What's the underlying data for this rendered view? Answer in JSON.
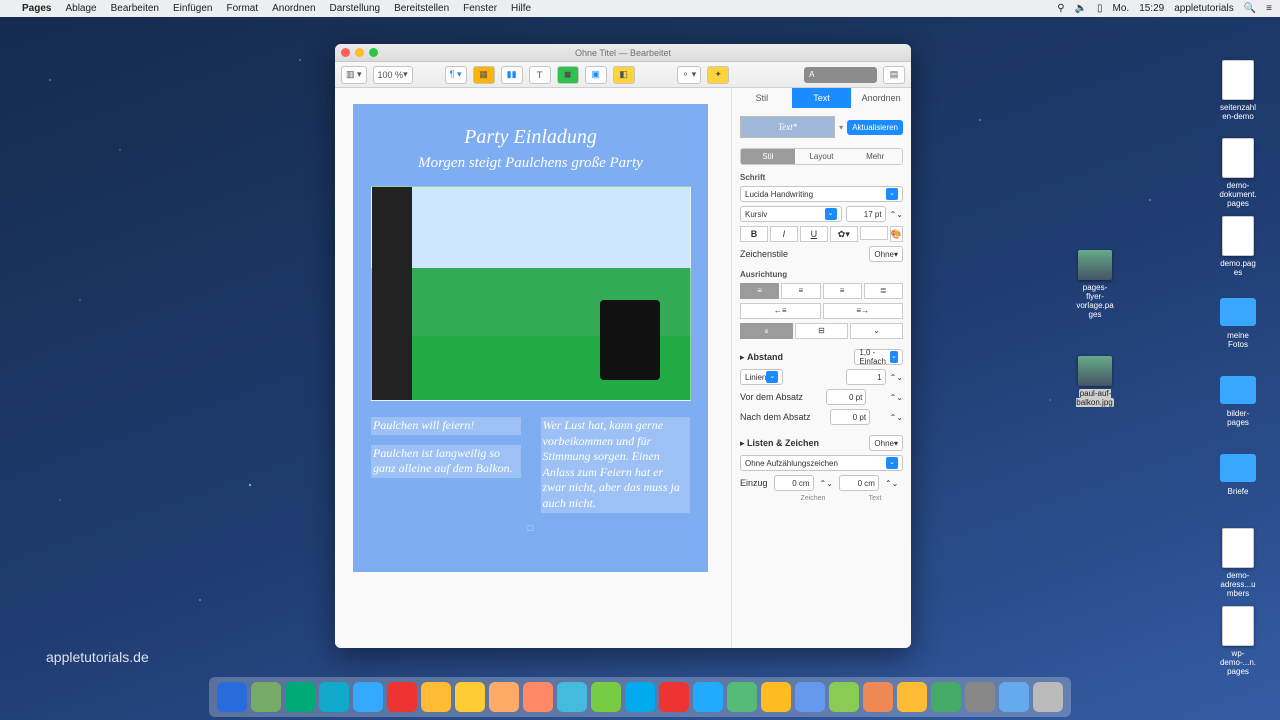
{
  "menubar": {
    "app": "Pages",
    "items": [
      "Ablage",
      "Bearbeiten",
      "Einfügen",
      "Format",
      "Anordnen",
      "Darstellung",
      "Bereitstellen",
      "Fenster",
      "Hilfe"
    ],
    "right": {
      "day": "Mo.",
      "time": "15:29",
      "user": "appletutorials"
    }
  },
  "window": {
    "title": "Ohne Titel — Bearbeitet",
    "zoom": "100 %"
  },
  "doc": {
    "title": "Party Einladung",
    "subtitle": "Morgen steigt Paulchens große Party",
    "col1a": "Paulchen will feiern!",
    "col1b": "Paulchen ist langweilig so ganz alleine auf dem Balkon.",
    "col2": "Wer Lust hat, kann gerne vorbeikommen und für Stimmung sorgen. Einen Anlass zum Feiern hat er zwar nicht, aber das muss ja auch nicht."
  },
  "inspector": {
    "tabs": {
      "stil": "Stil",
      "text": "Text",
      "anordnen": "Anordnen"
    },
    "styleName": "Text*",
    "update": "Aktualisieren",
    "subtabs": {
      "stil": "Stil",
      "layout": "Layout",
      "mehr": "Mehr"
    },
    "font": {
      "label": "Schrift",
      "family": "Lucida Handwriting",
      "typeface": "Kursiv",
      "size": "17 pt",
      "charStyleLabel": "Zeichenstile",
      "charStyle": "Ohne"
    },
    "align": {
      "label": "Ausrichtung"
    },
    "spacing": {
      "label": "Abstand",
      "value": "1,0 - Einfach",
      "linesLabel": "Linien",
      "linesVal": "1",
      "beforeLabel": "Vor dem Absatz",
      "beforeVal": "0 pt",
      "afterLabel": "Nach dem Absatz",
      "afterVal": "0 pt"
    },
    "lists": {
      "label": "Listen & Zeichen",
      "value": "Ohne",
      "bulletStyle": "Ohne Aufzählungszeichen",
      "indentLabel": "Einzug",
      "indentBullet": "0 cm",
      "indentText": "0 cm",
      "colBullet": "Zeichen",
      "colText": "Text"
    }
  },
  "desktop": {
    "files": [
      "seitenzahlen-demo",
      "demo-dokument.pages",
      "demo.pages",
      "meine Fotos",
      "bilder-pages",
      "Briefe",
      "demo-adress...umbers",
      "wp-demo-...n.pages"
    ],
    "thumbLabel": "pages-flyer-vorlage.pages",
    "imgLabel": "paul-auf-balkon.jpg"
  },
  "logo": "appletutorials.de",
  "dock_colors": [
    "#2a6bdc",
    "#7a6",
    "#0a7",
    "#1ac",
    "#3af",
    "#e33",
    "#fb3",
    "#fc3",
    "#fa6",
    "#f86",
    "#4bd",
    "#7c4",
    "#0ae",
    "#e33",
    "#2af",
    "#5b7",
    "#fb2",
    "#69e",
    "#8c5",
    "#e85",
    "#fb3",
    "#4a6",
    "#888",
    "#6ae",
    "#bbb"
  ]
}
